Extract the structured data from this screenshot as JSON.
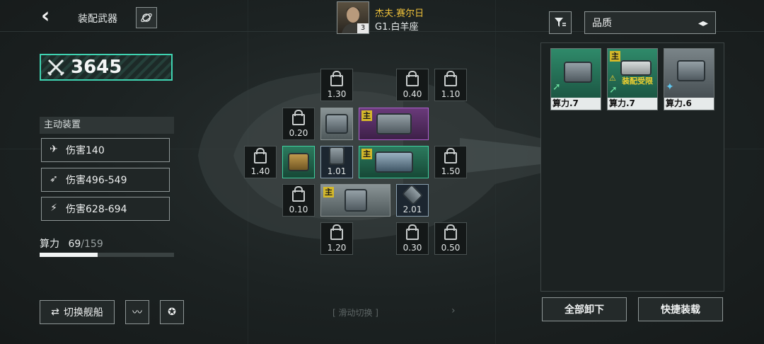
{
  "header": {
    "title": "装配武器"
  },
  "pilot": {
    "name": "杰夫.赛尔日",
    "ship": "G1.白羊座",
    "level": "3"
  },
  "power": {
    "value": "3645"
  },
  "active_devices": {
    "title": "主动装置",
    "stats": [
      "伤害140",
      "伤害496-549",
      "伤害628-694"
    ]
  },
  "compute": {
    "label": "算力",
    "used": "69",
    "max": "/159",
    "fraction": 0.434
  },
  "bottom_left": {
    "switch_ship": "切换舰船"
  },
  "swipe_hint": "[ 滑动切换 ]",
  "slots": {
    "top": [
      "1.30",
      "0.40",
      "1.10"
    ],
    "row1_left": "0.20",
    "row2_left": "1.40",
    "row2_equip_small": "1.01",
    "row2_right": "1.50",
    "row3_left": "0.10",
    "row3_equip": "2.01",
    "bottom": [
      "1.20",
      "0.30",
      "0.50"
    ],
    "main_tag": "主"
  },
  "right_panel": {
    "quality_label": "品质",
    "cards": [
      {
        "label": "算力.7"
      },
      {
        "label": "算力.7",
        "tag": "主",
        "warning": "装配受限"
      },
      {
        "label": "算力.6"
      }
    ],
    "unequip_all": "全部卸下",
    "quick_equip": "快捷装载"
  }
}
